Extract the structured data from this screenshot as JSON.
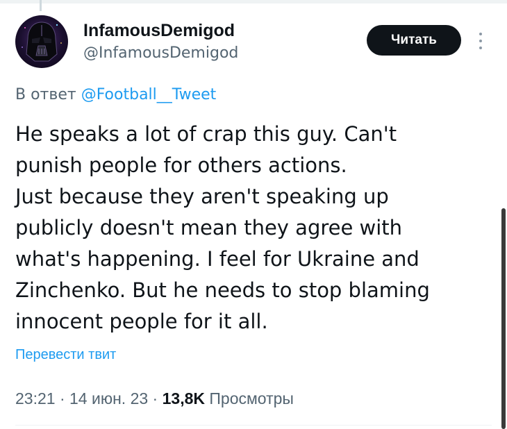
{
  "author": {
    "display_name": "InfamousDemigod",
    "handle": "@InfamousDemigod",
    "avatar_icon": "darth-vader-avatar"
  },
  "follow_button": {
    "label": "Читать"
  },
  "reply": {
    "prefix": "В ответ",
    "mention": "@Football__Tweet"
  },
  "tweet": {
    "lines": [
      "He speaks a lot of crap this guy. Can't",
      "punish people for others actions.",
      "Just because they aren't speaking up",
      "publicly doesn't mean they agree with",
      "what's happening. I feel for Ukraine and",
      "Zinchenko. But he needs to stop blaming",
      "innocent people for it all."
    ]
  },
  "translate_label": "Перевести твит",
  "meta": {
    "time": "23:21",
    "date": "14 июн. 23",
    "views_count": "13,8K",
    "views_label": "Просмотры",
    "separator": "·"
  },
  "colors": {
    "accent": "#1d9bf0",
    "text_primary": "#0f1419",
    "text_secondary": "#536471",
    "button_bg": "#0f1419"
  }
}
